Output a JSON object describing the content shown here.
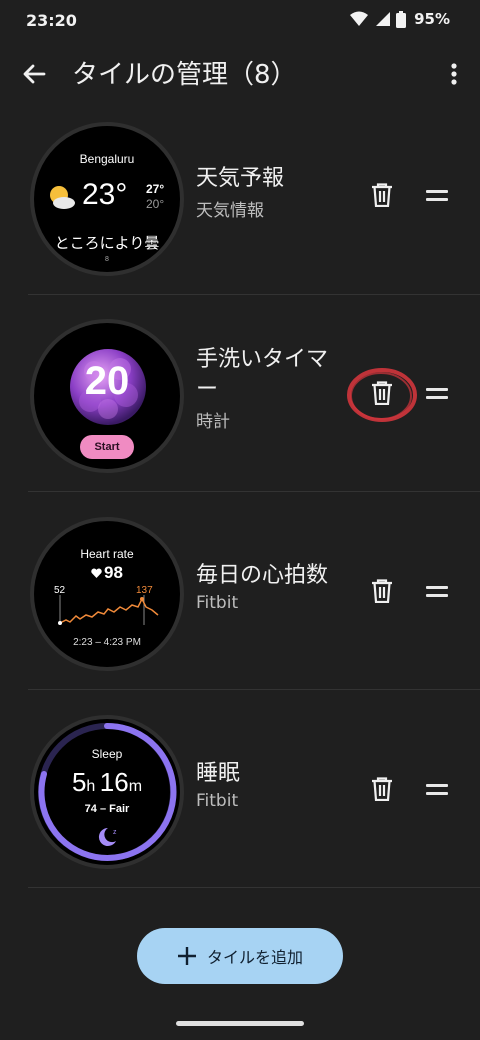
{
  "status": {
    "time": "23:20",
    "battery": "95%"
  },
  "appbar": {
    "title": "タイルの管理（8）"
  },
  "tiles": [
    {
      "name": "天気予報",
      "sub": "天気情報",
      "preview": {
        "city": "Bengaluru",
        "temp": "23°",
        "high": "27°",
        "low": "20°",
        "condition": "ところにより曇",
        "footer": "8"
      }
    },
    {
      "name": "手洗いタイマー",
      "sub": "時計",
      "preview": {
        "count": "20",
        "button": "Start"
      }
    },
    {
      "name": "毎日の心拍数",
      "sub": "Fitbit",
      "preview": {
        "title": "Heart rate",
        "value": "98",
        "min": "52",
        "max": "137",
        "range": "2:23 – 4:23 PM"
      }
    },
    {
      "name": "睡眠",
      "sub": "Fitbit",
      "preview": {
        "title": "Sleep",
        "hours": "5",
        "h_unit": "h",
        "minutes": "16",
        "m_unit": "m",
        "score": "74 – Fair"
      }
    }
  ],
  "add_button": {
    "label": "タイルを追加"
  },
  "colors": {
    "background": "#1f1f1f",
    "accent_button": "#a7d3f3",
    "highlight_circle": "#d0353c",
    "heart_line": "#f08a3a",
    "sleep_ring": "#8c74f0"
  }
}
